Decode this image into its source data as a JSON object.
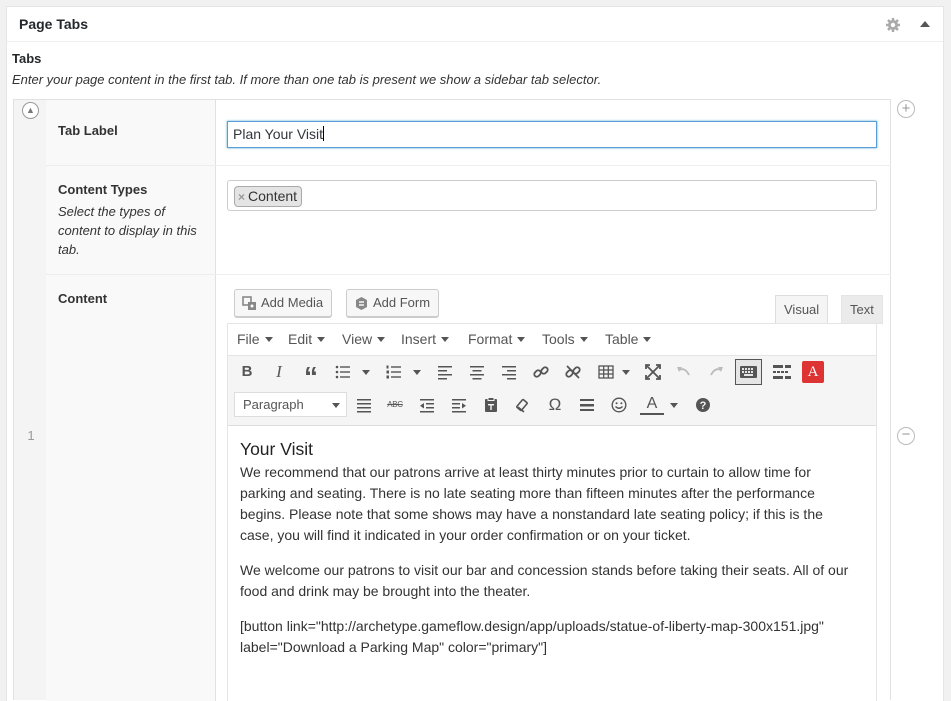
{
  "metabox": {
    "title": "Page Tabs"
  },
  "tabs_field": {
    "label": "Tabs",
    "description": "Enter your page content in the first tab. If more than one tab is present we show a sidebar tab selector."
  },
  "row": {
    "number": "1",
    "tab_label": {
      "label": "Tab Label",
      "value": "Plan Your Visit"
    },
    "content_types": {
      "label": "Content Types",
      "description": "Select the types of content to display in this tab.",
      "selected": "Content",
      "remove_symbol": "×"
    },
    "content": {
      "label": "Content",
      "add_media": "Add Media",
      "add_form": "Add Form",
      "tab_visual": "Visual",
      "tab_text": "Text",
      "menu": [
        "File",
        "Edit",
        "View",
        "Insert",
        "Format",
        "Tools",
        "Table"
      ],
      "format_select": "Paragraph",
      "heading": "Your Visit",
      "paragraphs": [
        "We recommend that our patrons arrive at least thirty minutes prior to curtain to allow time for parking and seating. There is no late seating more than fifteen minutes after the performance begins. Please note that some shows may have a nonstandard late seating policy; if this is the case, you will find it indicated in your order confirmation or on your ticket.",
        "We welcome our patrons to visit our bar and concession stands before taking their seats. All of our food and drink may be brought into the theater.",
        "[button link=\"http://archetype.gameflow.design/app/uploads/statue-of-liberty-map-300x151.jpg\" label=\"Download a Parking Map\" color=\"primary\"]"
      ]
    }
  },
  "toolbar_glyphs": {
    "bold": "B",
    "italic": "I",
    "quote": "“",
    "omega": "Ω",
    "abc": "ABC",
    "help": "?",
    "text_color": "A",
    "red_a": "A"
  },
  "colors": {
    "accent": "#0073aa",
    "red": "#dd3333"
  }
}
